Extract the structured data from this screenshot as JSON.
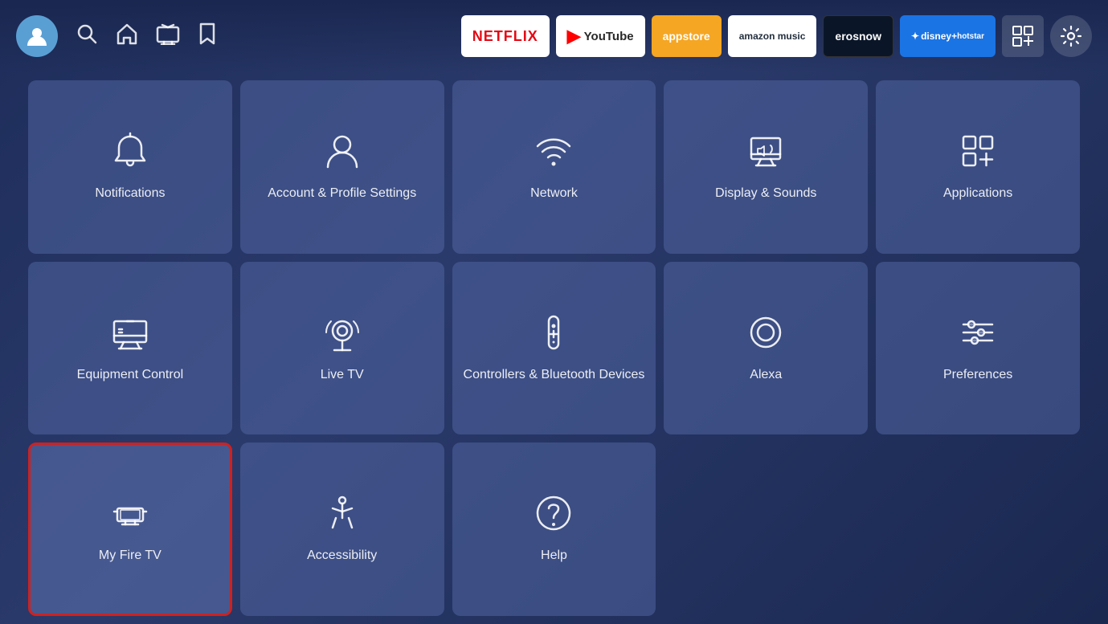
{
  "header": {
    "apps": [
      {
        "label": "NETFLIX",
        "key": "netflix"
      },
      {
        "label": "YouTube",
        "key": "youtube"
      },
      {
        "label": "appstore",
        "key": "appstore"
      },
      {
        "label": "amazon music",
        "key": "amazonmusic"
      },
      {
        "label": "erosnow",
        "key": "erosnow"
      },
      {
        "label": "disney+ hotstar",
        "key": "hotstar"
      }
    ],
    "settings_label": "⚙"
  },
  "tiles": [
    {
      "id": "notifications",
      "label": "Notifications",
      "icon": "bell",
      "selected": false
    },
    {
      "id": "account-profile",
      "label": "Account & Profile Settings",
      "icon": "person",
      "selected": false
    },
    {
      "id": "network",
      "label": "Network",
      "icon": "wifi",
      "selected": false
    },
    {
      "id": "display-sounds",
      "label": "Display & Sounds",
      "icon": "display",
      "selected": false
    },
    {
      "id": "applications",
      "label": "Applications",
      "icon": "apps",
      "selected": false
    },
    {
      "id": "equipment-control",
      "label": "Equipment Control",
      "icon": "tv",
      "selected": false
    },
    {
      "id": "live-tv",
      "label": "Live TV",
      "icon": "antenna",
      "selected": false
    },
    {
      "id": "controllers-bluetooth",
      "label": "Controllers & Bluetooth Devices",
      "icon": "remote",
      "selected": false
    },
    {
      "id": "alexa",
      "label": "Alexa",
      "icon": "alexa",
      "selected": false
    },
    {
      "id": "preferences",
      "label": "Preferences",
      "icon": "sliders",
      "selected": false
    },
    {
      "id": "my-fire-tv",
      "label": "My Fire TV",
      "icon": "firetv",
      "selected": true
    },
    {
      "id": "accessibility",
      "label": "Accessibility",
      "icon": "accessibility",
      "selected": false
    },
    {
      "id": "help",
      "label": "Help",
      "icon": "help",
      "selected": false
    }
  ]
}
